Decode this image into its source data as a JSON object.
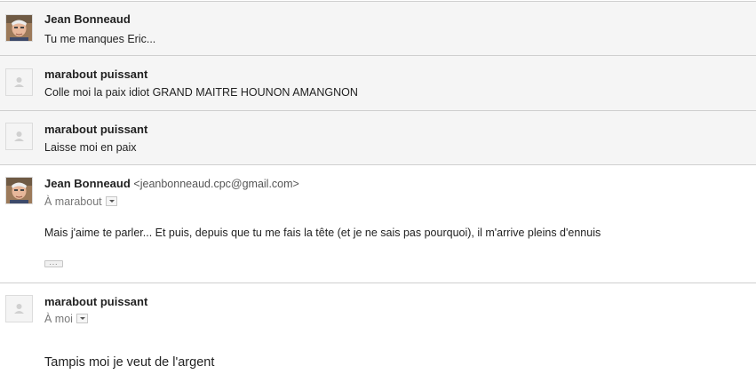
{
  "messages": [
    {
      "sender": "Jean Bonneaud",
      "snippet": "Tu me manques Eric..."
    },
    {
      "sender": "marabout puissant",
      "snippet": "Colle moi la paix idiot GRAND MAITRE HOUNON AMANGNON"
    },
    {
      "sender": "marabout puissant",
      "snippet": "Laisse moi en paix"
    },
    {
      "sender": "Jean Bonneaud",
      "email": "<jeanbonneaud.cpc@gmail.com>",
      "to": "À marabout",
      "body": "Mais j'aime te parler... Et puis, depuis que tu me fais la tête (et je ne sais pas pourquoi), il m'arrive pleins d'ennuis",
      "more": "..."
    },
    {
      "sender": "marabout puissant",
      "to": "À moi",
      "body": "Tampis moi je veut de l'argent"
    }
  ]
}
